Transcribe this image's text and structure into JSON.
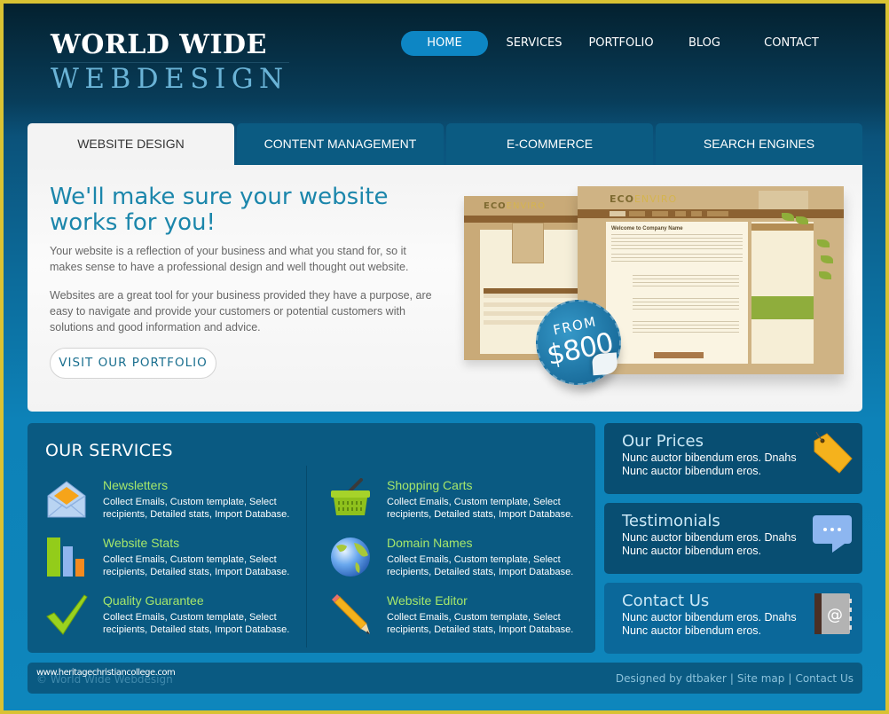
{
  "logo": {
    "line1": "WORLD WIDE",
    "line2": "WEBDESIGN"
  },
  "nav": {
    "items": [
      {
        "label": "HOME",
        "active": true
      },
      {
        "label": "SERVICES",
        "active": false
      },
      {
        "label": "PORTFOLIO",
        "active": false
      },
      {
        "label": "BLOG",
        "active": false
      },
      {
        "label": "CONTACT",
        "active": false
      }
    ]
  },
  "tabs": [
    {
      "label": "WEBSITE DESIGN",
      "active": true
    },
    {
      "label": "CONTENT MANAGEMENT",
      "active": false
    },
    {
      "label": "E-COMMERCE",
      "active": false
    },
    {
      "label": "SEARCH ENGINES",
      "active": false
    }
  ],
  "hero": {
    "title": "We'll make sure your website works for you!",
    "paragraph1": "Your website is a reflection of your business and what you stand for, so it makes sense to have a professional design and well thought out website.",
    "paragraph2": "Websites are a great tool for your business provided they have a purpose, are easy to navigate and provide your customers or potential customers with solutions and good information and advice.",
    "button_label": "VISIT OUR PORTFOLIO",
    "mockup": {
      "logo_part1": "ECO",
      "logo_part2": "ENVIRO",
      "heading": "Welcome to Company Name",
      "badge_from": "FROM",
      "badge_price": "$800"
    }
  },
  "services": {
    "title": "OUR SERVICES",
    "items": [
      {
        "name": "Newsletters",
        "icon": "envelope-icon",
        "description": "Collect Emails, Custom template, Select recipients, Detailed stats, Import Database."
      },
      {
        "name": "Website Stats",
        "icon": "bar-chart-icon",
        "description": "Collect Emails, Custom template, Select recipients, Detailed stats, Import Database."
      },
      {
        "name": "Quality Guarantee",
        "icon": "checkmark-icon",
        "description": "Collect Emails, Custom template, Select recipients, Detailed stats, Import Database."
      },
      {
        "name": "Shopping Carts",
        "icon": "shopping-basket-icon",
        "description": "Collect Emails, Custom template, Select recipients, Detailed stats, Import Database."
      },
      {
        "name": "Domain Names",
        "icon": "globe-icon",
        "description": "Collect Emails, Custom template, Select recipients, Detailed stats, Import Database."
      },
      {
        "name": "Website Editor",
        "icon": "pencil-icon",
        "description": "Collect Emails, Custom template, Select recipients, Detailed stats, Import Database."
      }
    ]
  },
  "side_boxes": [
    {
      "title": "Our Prices",
      "text": "Nunc auctor bibendum eros. Dnahs Nunc auctor bibendum eros.",
      "icon": "price-tag-icon"
    },
    {
      "title": "Testimonials",
      "text": "Nunc auctor bibendum eros. Dnahs Nunc auctor bibendum eros.",
      "icon": "speech-bubble-icon"
    },
    {
      "title": "Contact Us",
      "text": "Nunc auctor bibendum eros. Dnahs Nunc auctor bibendum eros.",
      "icon": "address-book-icon"
    }
  ],
  "footer": {
    "copyright": "© World Wide Webdesign",
    "watermark": "www.heritagechristiancollege.com",
    "links": [
      "Designed by dtbaker",
      "Site map",
      "Contact Us"
    ]
  },
  "colors": {
    "accent": "#0d86c4",
    "panel": "#0a5a82",
    "service_title": "#a5e66b",
    "frame": "#d9c233"
  }
}
